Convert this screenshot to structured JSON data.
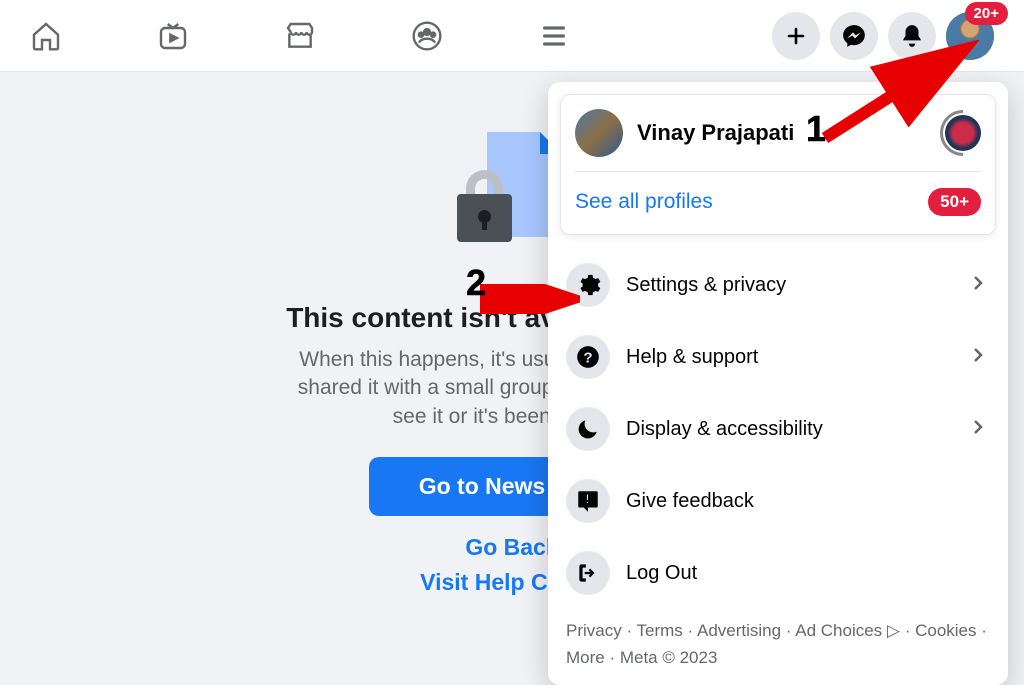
{
  "header": {
    "notification_badge": "20+"
  },
  "main": {
    "title": "This content isn't available right now",
    "title_truncated": "This content isn't available right n",
    "description": "When this happens, it's usually because the owner only shared it with a small group of people, changed who can see it or it's been deleted.",
    "description_truncated_line1": "When this happens, it's usually because the o",
    "description_truncated_line2": "shared it with a small group of people, change",
    "description_truncated_line3": "see it or it's been deleted.",
    "primary_button": "Go to News Feed",
    "go_back": "Go Back",
    "help_center": "Visit Help Center"
  },
  "dropdown": {
    "profile_name": "Vinay Prajapati",
    "see_all": "See all profiles",
    "profiles_badge": "50+",
    "menu": {
      "settings": "Settings & privacy",
      "help": "Help & support",
      "display": "Display & accessibility",
      "feedback": "Give feedback",
      "logout": "Log Out"
    },
    "footer": "Privacy · Terms · Advertising · Ad Choices ▷ · Cookies · More · Meta © 2023"
  },
  "annotations": {
    "label1": "1",
    "label2": "2"
  }
}
